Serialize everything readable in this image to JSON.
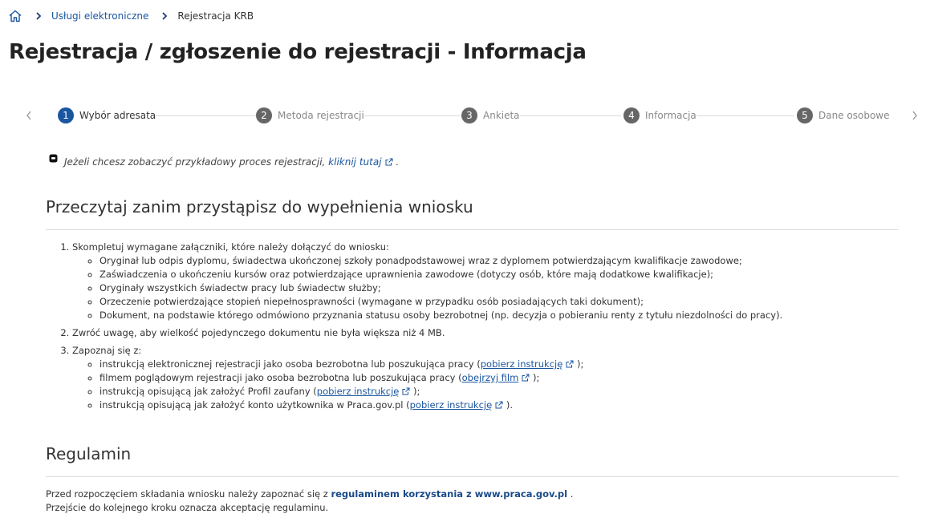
{
  "breadcrumb": {
    "home_icon": "home-icon",
    "items": [
      {
        "label": "Usługi elektroniczne"
      },
      {
        "label": "Rejestracja KRB"
      }
    ]
  },
  "title": "Rejestracja / zgłoszenie do rejestracji - Informacja",
  "stepper": {
    "steps": [
      {
        "number": "1",
        "label": "Wybór adresata",
        "active": true
      },
      {
        "number": "2",
        "label": "Metoda rejestracji",
        "active": false
      },
      {
        "number": "3",
        "label": "Ankieta",
        "active": false
      },
      {
        "number": "4",
        "label": "Informacja",
        "active": false
      },
      {
        "number": "5",
        "label": "Dane osobowe",
        "active": false
      }
    ],
    "accent_color": "#1a56a0",
    "inactive_color": "#666666"
  },
  "info": {
    "text": "Jeżeli chcesz zobaczyć przykładowy proces rejestracji,",
    "link": "kliknij tutaj",
    "suffix": "."
  },
  "read_section": {
    "heading": "Przeczytaj zanim przystąpisz do wypełnienia wniosku",
    "items": [
      {
        "text": "Skompletuj wymagane załączniki, które należy dołączyć do wniosku:",
        "sub": [
          "Oryginał lub odpis dyplomu, świadectwa ukończonej szkoły ponadpodstawowej wraz z dyplomem potwierdzającym kwalifikacje zawodowe;",
          "Zaświadczenia o ukończeniu kursów oraz potwierdzające uprawnienia zawodowe (dotyczy osób, które mają dodatkowe kwalifikacje);",
          "Oryginały wszystkich świadectw pracy lub świadectw służby;",
          "Orzeczenie potwierdzające stopień niepełnosprawności (wymagane w przypadku osób posiadających taki dokument);",
          "Dokument, na podstawie którego odmówiono przyznania statusu osoby bezrobotnej (np. decyzja o pobieraniu renty z tytułu niezdolności do pracy)."
        ]
      },
      {
        "text": "Zwróć uwagę, aby wielkość pojedynczego dokumentu nie była większa niż 4 MB."
      },
      {
        "text": "Zapoznaj się z:",
        "links": [
          {
            "pre": "instrukcją elektronicznej rejestracji jako osoba bezrobotna lub poszukująca pracy (",
            "link": "pobierz instrukcję",
            "post": " );"
          },
          {
            "pre": "filmem poglądowym rejestracji jako osoba bezrobotna lub poszukująca pracy (",
            "link": "obejrzyj film",
            "post": " );"
          },
          {
            "pre": "instrukcją opisującą jak założyć Profil zaufany (",
            "link": "pobierz instrukcję",
            "post": " );"
          },
          {
            "pre": "instrukcją opisującą jak założyć konto użytkownika w Praca.gov.pl (",
            "link": "pobierz instrukcję",
            "post": " )."
          }
        ]
      }
    ]
  },
  "regulamin": {
    "heading": "Regulamin",
    "line1_pre": "Przed rozpoczęciem składania wniosku należy zapoznać się z",
    "line1_link": "regulaminem korzystania z www.praca.gov.pl",
    "line1_post": ".",
    "line2": "Przejście do kolejnego kroku oznacza akceptację regulaminu."
  }
}
